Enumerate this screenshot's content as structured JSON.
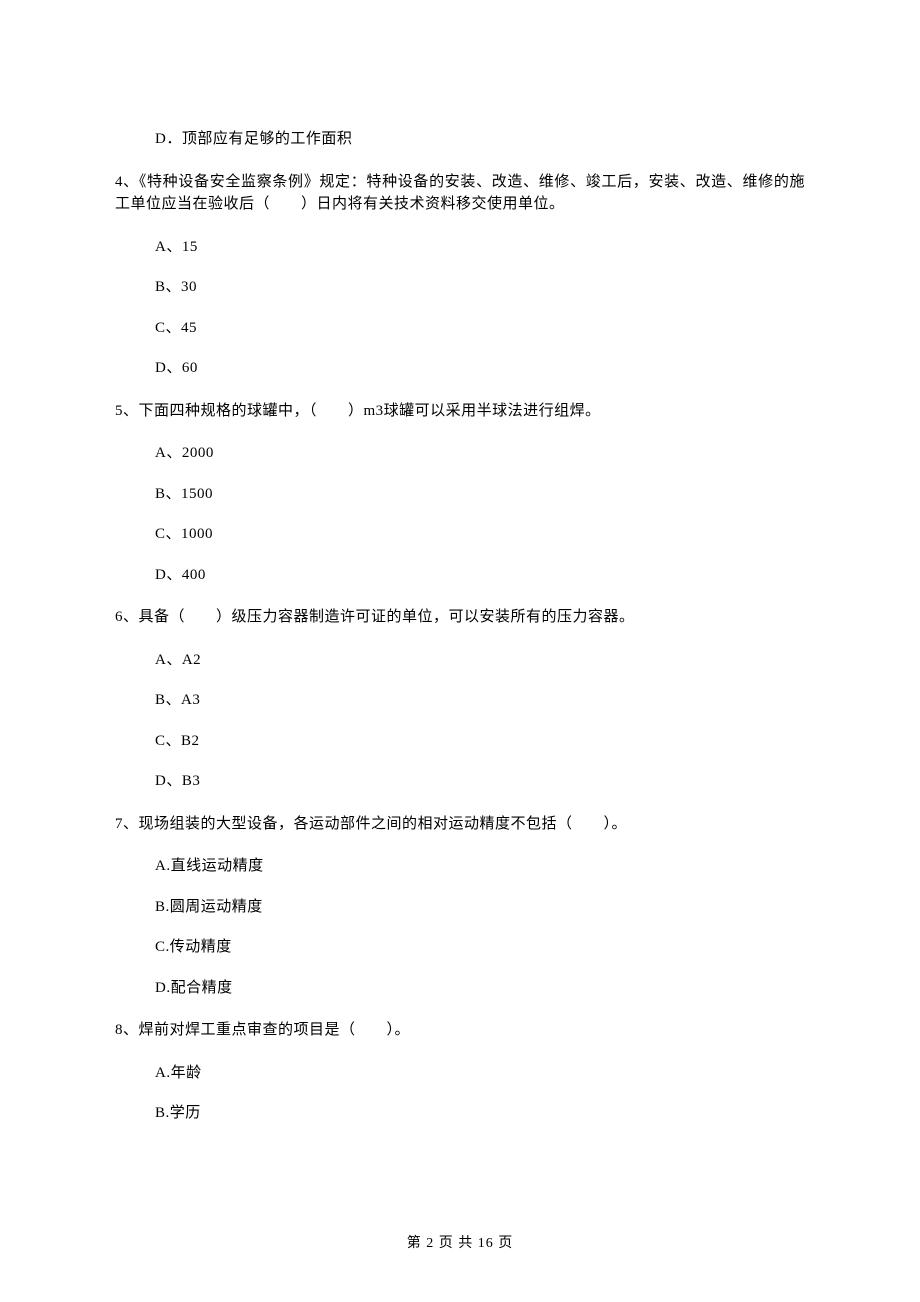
{
  "q3": {
    "optD": "D．顶部应有足够的工作面积"
  },
  "q4": {
    "text": "4、《特种设备安全监察条例》规定：特种设备的安装、改造、维修、竣工后，安装、改造、维修的施工单位应当在验收后（　　）日内将有关技术资料移交使用单位。",
    "optA": "A、15",
    "optB": "B、30",
    "optC": "C、45",
    "optD": "D、60"
  },
  "q5": {
    "text": "5、下面四种规格的球罐中，（　　）m3球罐可以采用半球法进行组焊。",
    "optA": "A、2000",
    "optB": "B、1500",
    "optC": "C、1000",
    "optD": "D、400"
  },
  "q6": {
    "text": "6、具备（　　）级压力容器制造许可证的单位，可以安装所有的压力容器。",
    "optA": "A、A2",
    "optB": "B、A3",
    "optC": "C、B2",
    "optD": "D、B3"
  },
  "q7": {
    "text": "7、现场组装的大型设备，各运动部件之间的相对运动精度不包括（　　）。",
    "optA": "A.直线运动精度",
    "optB": "B.圆周运动精度",
    "optC": "C.传动精度",
    "optD": "D.配合精度"
  },
  "q8": {
    "text": "8、焊前对焊工重点审查的项目是（　　）。",
    "optA": "A.年龄",
    "optB": "B.学历"
  },
  "footer": "第 2 页 共 16 页"
}
